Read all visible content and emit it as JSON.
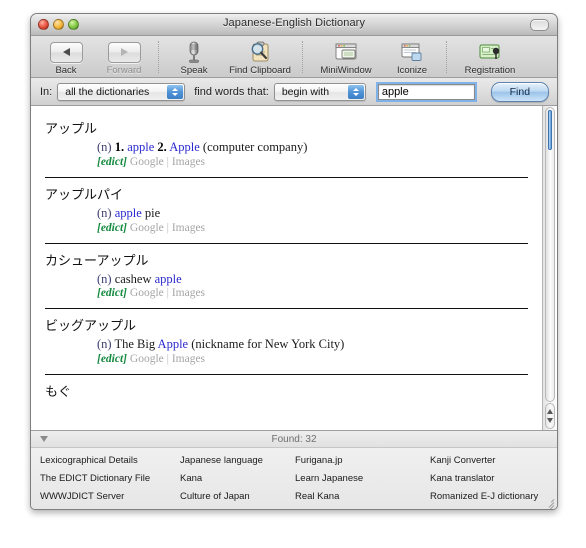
{
  "window": {
    "title": "Japanese-English Dictionary",
    "controls": {
      "close": "close-button",
      "minimize": "minimize-button",
      "zoom": "zoom-button",
      "toolbar_toggle": "toolbar-toggle-button"
    }
  },
  "toolbar": {
    "items": [
      {
        "label": "Back",
        "icon": "back-arrow-icon",
        "enabled": true
      },
      {
        "label": "Forward",
        "icon": "forward-arrow-icon",
        "enabled": false
      },
      {
        "label": "Speak",
        "icon": "microphone-icon",
        "enabled": true
      },
      {
        "label": "Find Clipboard",
        "icon": "clipboard-search-icon",
        "enabled": true
      },
      {
        "label": "MiniWindow",
        "icon": "mini-window-icon",
        "enabled": true
      },
      {
        "label": "Iconize",
        "icon": "iconize-window-icon",
        "enabled": true
      },
      {
        "label": "Registration",
        "icon": "registration-icon",
        "enabled": true
      }
    ]
  },
  "search": {
    "in_label": "In:",
    "dictionary_value": "all the dictionaries",
    "find_words_label": "find words that:",
    "match_value": "begin with",
    "query_value": "apple",
    "query_placeholder": "",
    "find_label": "Find"
  },
  "results": {
    "entries": [
      {
        "headword": "アップル",
        "pos": "(n)",
        "senses": [
          {
            "num": "1.",
            "gloss": "apple",
            "is_link": true
          },
          {
            "num": "2.",
            "gloss": "Apple",
            "is_link": true
          }
        ],
        "note": "(computer company)",
        "plain_before": "",
        "plain_after": "",
        "source": "[edict]",
        "google_label": "Google",
        "separator": "|",
        "images_label": "Images"
      },
      {
        "headword": "アップルパイ",
        "pos": "(n)",
        "senses": [
          {
            "num": "",
            "gloss": "apple",
            "is_link": true
          }
        ],
        "note": "",
        "plain_before": "",
        "plain_after": "pie",
        "source": "[edict]",
        "google_label": "Google",
        "separator": "|",
        "images_label": "Images"
      },
      {
        "headword": "カシューアップル",
        "pos": "(n)",
        "senses": [
          {
            "num": "",
            "gloss": "apple",
            "is_link": true
          }
        ],
        "note": "",
        "plain_before": "cashew",
        "plain_after": "",
        "source": "[edict]",
        "google_label": "Google",
        "separator": "|",
        "images_label": "Images"
      },
      {
        "headword": "ビッグアップル",
        "pos": "(n)",
        "senses": [
          {
            "num": "",
            "gloss": "Apple",
            "is_link": true
          }
        ],
        "note": "(nickname for New York City)",
        "plain_before": "The Big",
        "plain_after": "",
        "source": "[edict]",
        "google_label": "Google",
        "separator": "|",
        "images_label": "Images"
      },
      {
        "headword": "もぐ",
        "pos": "",
        "senses": [],
        "note": "",
        "plain_before": "",
        "plain_after": "",
        "source": "",
        "google_label": "",
        "separator": "",
        "images_label": ""
      }
    ]
  },
  "status": {
    "found_text": "Found: 32",
    "disclosure": "disclosure-triangle"
  },
  "links": [
    "Lexicographical Details",
    "Japanese language",
    "Furigana.jp",
    "Kanji Converter",
    "The EDICT Dictionary File",
    "Kana",
    "Learn Japanese",
    "Kana translator",
    "WWWJDICT Server",
    "Culture of Japan",
    "Real Kana",
    "Romanized E-J dictionary"
  ],
  "colors": {
    "link_blue": "#2a2ad0",
    "source_green": "#138a3e",
    "meta_gray": "#a5a5a5",
    "accent_aqua": "#4f92d6"
  }
}
